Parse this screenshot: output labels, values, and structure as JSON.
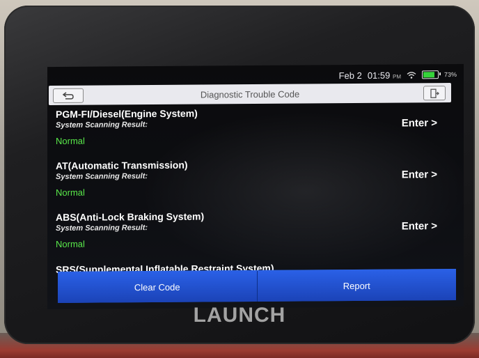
{
  "status_bar": {
    "date": "Feb 2",
    "time": "01:59",
    "ampm": "PM",
    "battery": "73%",
    "battery_level": 0.73,
    "icons": [
      "wifi-icon",
      "battery-icon"
    ]
  },
  "header": {
    "title": "Diagnostic Trouble Code",
    "back_icon": "back-arrow-icon",
    "exit_icon": "exit-door-icon"
  },
  "systems": [
    {
      "name": "PGM-FI/Diesel(Engine System)",
      "result_label": "System Scanning Result:",
      "result": "Normal",
      "action": "Enter >"
    },
    {
      "name": "AT(Automatic Transmission)",
      "result_label": "System Scanning Result:",
      "result": "Normal",
      "action": "Enter >"
    },
    {
      "name": "ABS(Anti-Lock Braking System)",
      "result_label": "System Scanning Result:",
      "result": "Normal",
      "action": "Enter >"
    },
    {
      "name": "SRS(Supplemental Inflatable Restraint System)"
    }
  ],
  "footer": {
    "clear_code": "Clear Code",
    "report": "Report"
  },
  "brand": "LAUNCH",
  "colors": {
    "normal_status": "#59e84a",
    "button_blue": "#2a60e6",
    "battery_green": "#36d33a"
  }
}
